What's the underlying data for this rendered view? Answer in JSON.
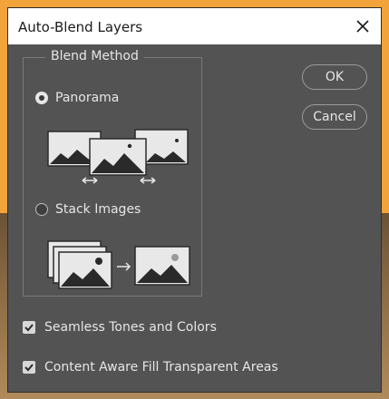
{
  "dialog": {
    "title": "Auto-Blend Layers",
    "close_icon": "close-icon"
  },
  "blend_method": {
    "legend": "Blend Method",
    "options": [
      {
        "label": "Panorama",
        "selected": true
      },
      {
        "label": "Stack Images",
        "selected": false
      }
    ]
  },
  "buttons": {
    "ok_label": "OK",
    "cancel_label": "Cancel"
  },
  "checkboxes": [
    {
      "label": "Seamless Tones and Colors",
      "checked": true
    },
    {
      "label": "Content Aware Fill Transparent Areas",
      "checked": true
    }
  ],
  "colors": {
    "frame": "#f2a33a",
    "dialog_bg": "#535353",
    "text": "#e6e6e6"
  }
}
